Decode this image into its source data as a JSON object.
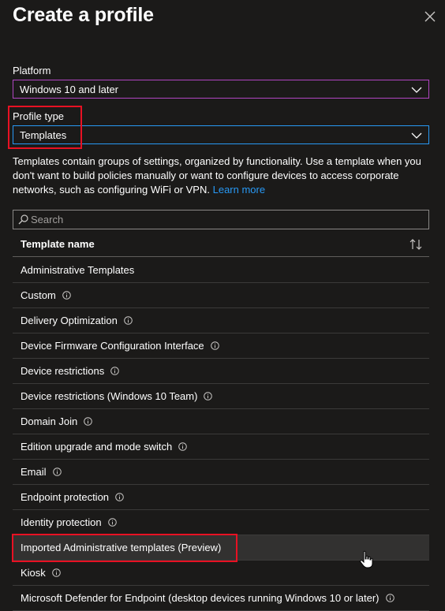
{
  "panel": {
    "title": "Create a profile"
  },
  "platform": {
    "label": "Platform",
    "value": "Windows 10 and later"
  },
  "profile_type": {
    "label": "Profile type",
    "value": "Templates"
  },
  "description": {
    "text": "Templates contain groups of settings, organized by functionality. Use a template when you don't want to build policies manually or want to configure devices to access corporate networks, such as configuring WiFi or VPN.",
    "link": "Learn more"
  },
  "search": {
    "placeholder": "Search"
  },
  "table": {
    "header": "Template name",
    "rows": [
      {
        "name": "Administrative Templates",
        "info": false
      },
      {
        "name": "Custom",
        "info": true
      },
      {
        "name": "Delivery Optimization",
        "info": true
      },
      {
        "name": "Device Firmware Configuration Interface",
        "info": true
      },
      {
        "name": "Device restrictions",
        "info": true
      },
      {
        "name": "Device restrictions (Windows 10 Team)",
        "info": true
      },
      {
        "name": "Domain Join",
        "info": true
      },
      {
        "name": "Edition upgrade and mode switch",
        "info": true
      },
      {
        "name": "Email",
        "info": true
      },
      {
        "name": "Endpoint protection",
        "info": true
      },
      {
        "name": "Identity protection",
        "info": true
      },
      {
        "name": "Imported Administrative templates (Preview)",
        "info": false,
        "hovered": true
      },
      {
        "name": "Kiosk",
        "info": true
      },
      {
        "name": "Microsoft Defender for Endpoint (desktop devices running Windows 10 or later)",
        "info": true
      }
    ]
  },
  "colors": {
    "background": "#1b1a19",
    "link": "#2899f5",
    "focus_border": "#2899f5",
    "platform_border": "#b146c2",
    "highlight_red": "#e81123"
  }
}
